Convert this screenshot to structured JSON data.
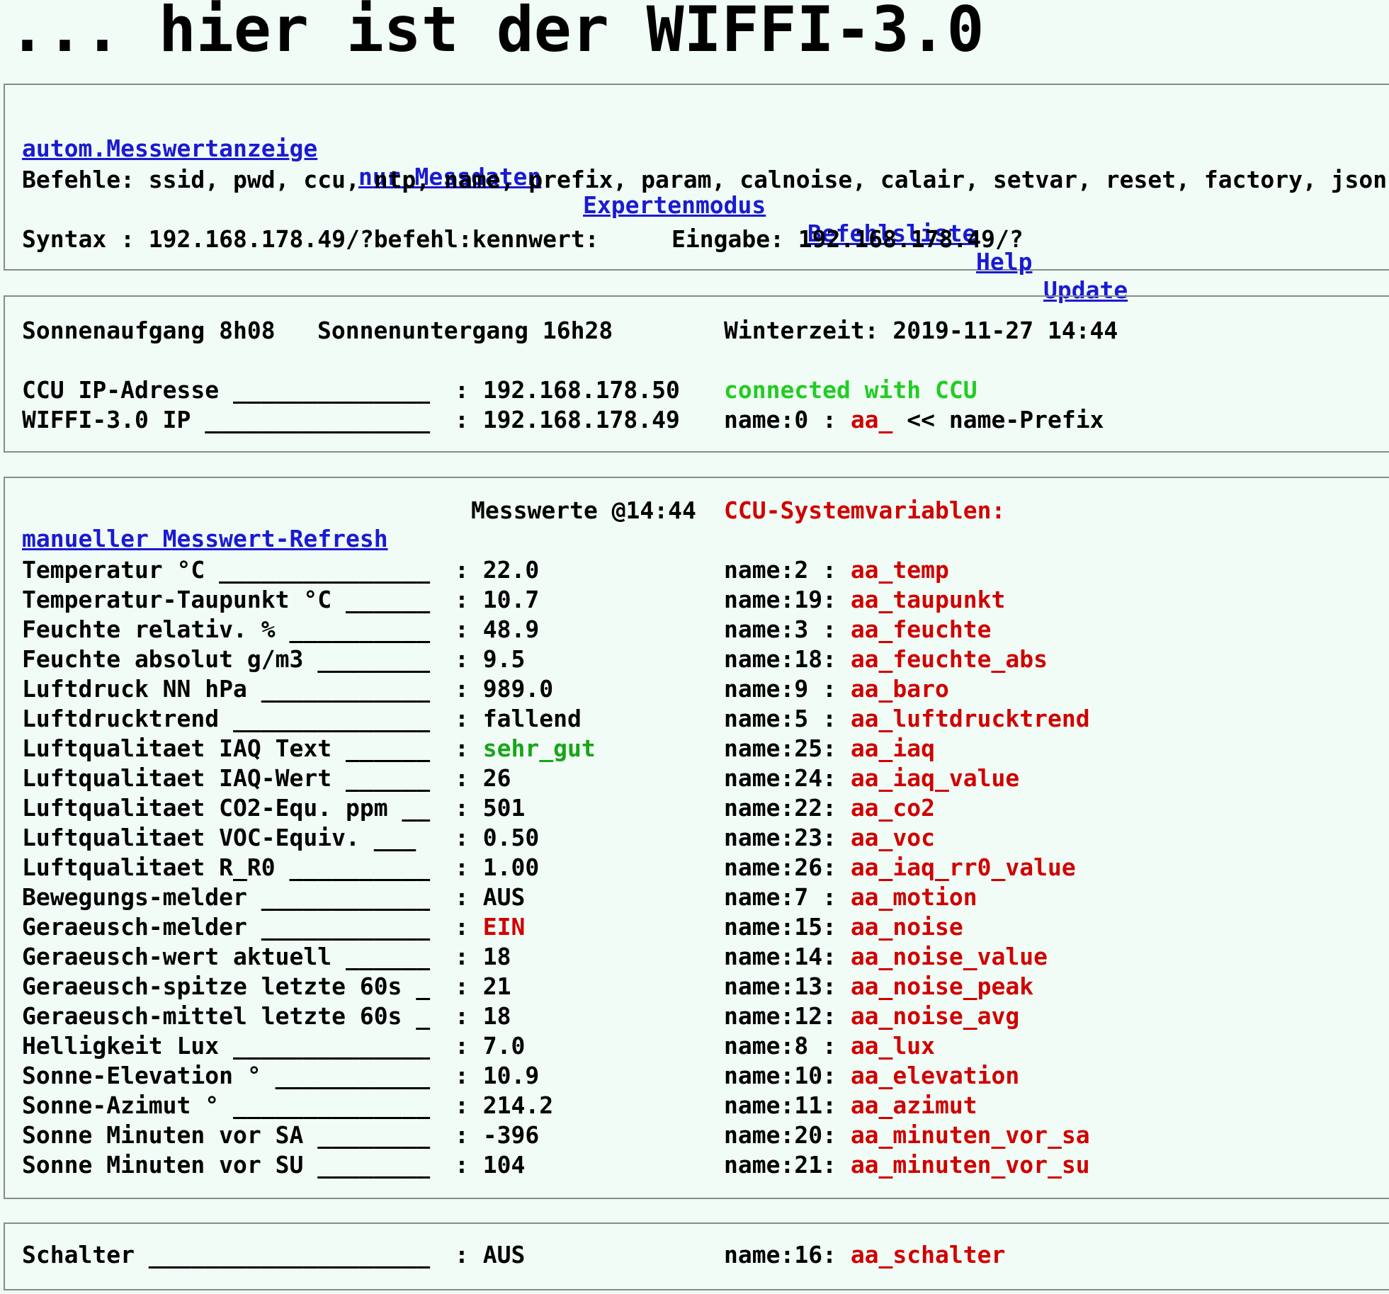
{
  "page_title": "... hier ist der WIFFI-3.0",
  "nav": [
    {
      "label": "autom.Messwertanzeige"
    },
    {
      "label": "nur Messdaten"
    },
    {
      "label": "Expertenmodus"
    },
    {
      "label": "Befehlsliste"
    },
    {
      "label": "Help"
    },
    {
      "label": "Update"
    }
  ],
  "commands_line": "Befehle: ssid, pwd, ccu, ntp, name, prefix, param, calnoise, calair, setvar, reset, factory, json",
  "syntax_line": "Syntax : 192.168.178.49/?befehl:kennwert:",
  "eingabe_line": "Eingabe: 192.168.178.49/?",
  "sun": {
    "sunrise": "Sonnenaufgang 8h08",
    "sunset": "Sonnenuntergang 16h28",
    "time": "Winterzeit: 2019-11-27 14:44"
  },
  "network": {
    "ccu_label": "CCU IP-Adresse ______________",
    "ccu_value": ": 192.168.178.50",
    "status": "connected with CCU",
    "wiffi_label": "WIFFI-3.0 IP ________________",
    "wiffi_value": ": 192.168.178.49",
    "name_key": "name:0 : ",
    "name_value": "aa_",
    "name_suffix": " << name-Prefix"
  },
  "measure_header": {
    "refresh_link": "manueller Messwert-Refresh",
    "timestamp": "Messwerte @14:44",
    "sysvar_title": "CCU-Systemvariablen:"
  },
  "measurements": [
    {
      "label": "Temperatur °C _______________",
      "value": ": 22.0",
      "key": "name:2 : ",
      "var": "aa_temp",
      "cls": ""
    },
    {
      "label": "Temperatur-Taupunkt °C ______",
      "value": ": 10.7",
      "key": "name:19: ",
      "var": "aa_taupunkt",
      "cls": ""
    },
    {
      "label": "Feuchte relativ. % __________",
      "value": ": 48.9",
      "key": "name:3 : ",
      "var": "aa_feuchte",
      "cls": ""
    },
    {
      "label": "Feuchte absolut g/m3 ________",
      "value": ": 9.5",
      "key": "name:18: ",
      "var": "aa_feuchte_abs",
      "cls": ""
    },
    {
      "label": "Luftdruck NN hPa ____________",
      "value": ": 989.0",
      "key": "name:9 : ",
      "var": "aa_baro",
      "cls": ""
    },
    {
      "label": "Luftdrucktrend ______________",
      "value": ": fallend",
      "key": "name:5 : ",
      "var": "aa_luftdrucktrend",
      "cls": ""
    },
    {
      "label": "Luftqualitaet IAQ Text ______",
      "value": ": ",
      "value_colored": "sehr_gut",
      "key": "name:25: ",
      "var": "aa_iaq",
      "cls": "greenv"
    },
    {
      "label": "Luftqualitaet IAQ-Wert ______",
      "value": ": 26",
      "key": "name:24: ",
      "var": "aa_iaq_value",
      "cls": ""
    },
    {
      "label": "Luftqualitaet CO2-Equ. ppm __",
      "value": ": 501",
      "key": "name:22: ",
      "var": "aa_co2",
      "cls": ""
    },
    {
      "label": "Luftqualitaet VOC-Equiv. ___",
      "value": ": 0.50",
      "key": "name:23: ",
      "var": "aa_voc",
      "cls": ""
    },
    {
      "label": "Luftqualitaet R_R0 __________",
      "value": ": 1.00",
      "key": "name:26: ",
      "var": "aa_iaq_rr0_value",
      "cls": ""
    },
    {
      "label": "Bewegungs-melder ____________",
      "value": ": AUS",
      "key": "name:7 : ",
      "var": "aa_motion",
      "cls": ""
    },
    {
      "label": "Geraeusch-melder ____________",
      "value": ": ",
      "value_colored": "EIN",
      "key": "name:15: ",
      "var": "aa_noise",
      "cls": "red"
    },
    {
      "label": "Geraeusch-wert aktuell ______",
      "value": ": 18",
      "key": "name:14: ",
      "var": "aa_noise_value",
      "cls": ""
    },
    {
      "label": "Geraeusch-spitze letzte 60s _",
      "value": ": 21",
      "key": "name:13: ",
      "var": "aa_noise_peak",
      "cls": ""
    },
    {
      "label": "Geraeusch-mittel letzte 60s _",
      "value": ": 18",
      "key": "name:12: ",
      "var": "aa_noise_avg",
      "cls": ""
    },
    {
      "label": "Helligkeit Lux ______________",
      "value": ": 7.0",
      "key": "name:8 : ",
      "var": "aa_lux",
      "cls": ""
    },
    {
      "label": "Sonne-Elevation ° ___________",
      "value": ": 10.9",
      "key": "name:10: ",
      "var": "aa_elevation",
      "cls": ""
    },
    {
      "label": "Sonne-Azimut ° ______________",
      "value": ": 214.2",
      "key": "name:11: ",
      "var": "aa_azimut",
      "cls": ""
    },
    {
      "label": "Sonne Minuten vor SA ________",
      "value": ": -396",
      "key": "name:20: ",
      "var": "aa_minuten_vor_sa",
      "cls": ""
    },
    {
      "label": "Sonne Minuten vor SU ________",
      "value": ": 104",
      "key": "name:21: ",
      "var": "aa_minuten_vor_su",
      "cls": ""
    }
  ],
  "switch": {
    "label": "Schalter ____________________",
    "value": ": AUS",
    "key": "name:16: ",
    "var": "aa_schalter"
  },
  "colors": {
    "link": "#1a1ad2",
    "var": "#d00000",
    "connected": "#22cc22",
    "good": "#18a518",
    "background": "#f0fcf5"
  }
}
